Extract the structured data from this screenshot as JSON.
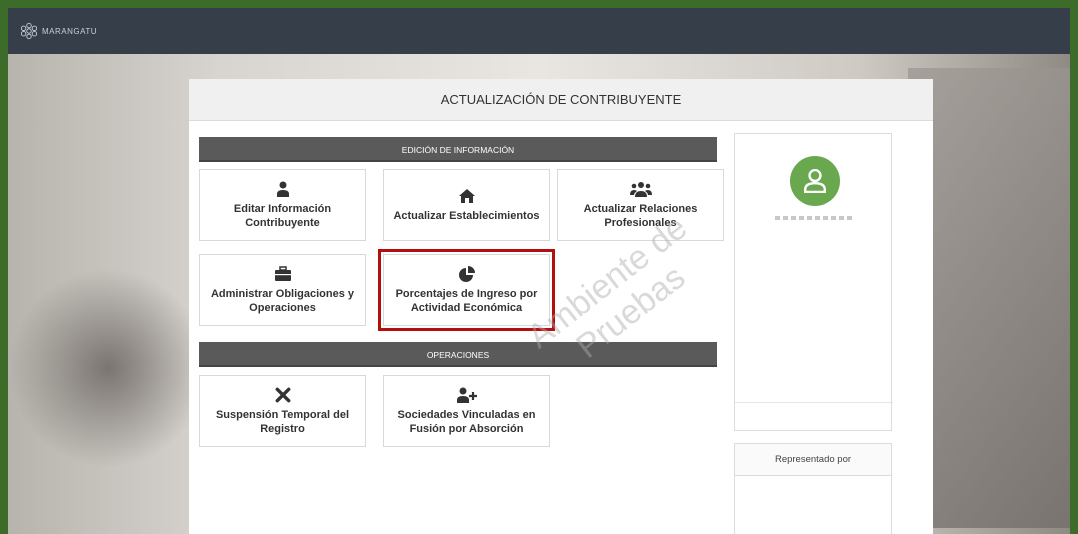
{
  "app": {
    "logo_text": "MARANGATU"
  },
  "panel": {
    "title": "ACTUALIZACIÓN DE CONTRIBUYENTE"
  },
  "sections": {
    "edicion": "EDICIÓN DE INFORMACIÓN",
    "operaciones": "OPERACIONES"
  },
  "tiles": {
    "editar": {
      "line1": "Editar Información",
      "line2": "Contribuyente",
      "icon": "user-icon"
    },
    "establecimientos": {
      "line1": "Actualizar Establecimientos",
      "line2": "",
      "icon": "home-icon"
    },
    "relaciones": {
      "line1": "Actualizar Relaciones",
      "line2": "Profesionales",
      "icon": "users-icon"
    },
    "obligaciones": {
      "line1": "Administrar Obligaciones y",
      "line2": "Operaciones",
      "icon": "briefcase-icon"
    },
    "porcentajes": {
      "line1": "Porcentajes de Ingreso por",
      "line2": "Actividad Económica",
      "icon": "pie-chart-icon"
    },
    "suspension": {
      "line1": "Suspensión Temporal del",
      "line2": "Registro",
      "icon": "close-icon"
    },
    "sociedades": {
      "line1": "Sociedades Vinculadas en",
      "line2": "Fusión por Absorción",
      "icon": "user-plus-icon"
    }
  },
  "side": {
    "represented_label": "Representado por"
  },
  "watermark": {
    "line1": "Ambiente de",
    "line2": "Pruebas"
  },
  "colors": {
    "highlight": "#b30f0f",
    "avatar": "#6aa84f",
    "section_bar": "#5a5a5a",
    "topbar": "#363f49"
  }
}
